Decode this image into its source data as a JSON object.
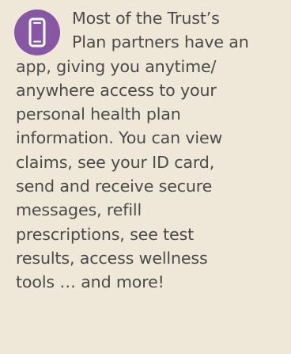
{
  "colors": {
    "background": "#efe7d7",
    "badge": "#8757a3",
    "text": "#4a4a4a",
    "icon_stroke": "#ffffff"
  },
  "icon": {
    "name": "smartphone-icon"
  },
  "paragraph": {
    "lines": [
      "Most of the Trust’s",
      "Plan partners have an",
      "app, giving you anytime/",
      "anywhere access to your",
      "personal health plan",
      "information. You can view",
      "claims, see your ID card,",
      "send and receive secure",
      "messages, refill",
      "prescriptions, see test",
      "results, access wellness",
      "tools … and more!"
    ]
  }
}
